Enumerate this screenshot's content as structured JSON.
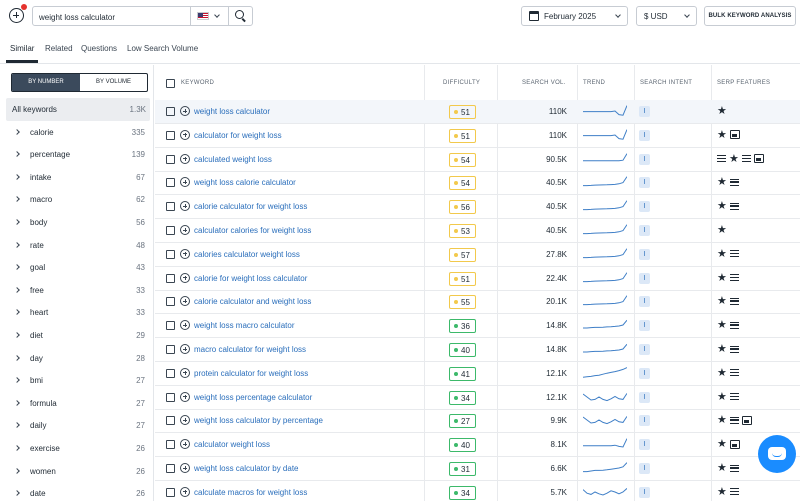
{
  "search": {
    "query": "weight loss calculator"
  },
  "date_dropdown": {
    "label": "February 2025"
  },
  "currency_dropdown": {
    "label": "$ USD"
  },
  "bulk_button": {
    "label": "BULK KEYWORD ANALYSIS"
  },
  "tabs": [
    "Similar",
    "Related",
    "Questions",
    "Low Search Volume"
  ],
  "toggle": {
    "by_number": "BY NUMBER",
    "by_volume": "BY VOLUME"
  },
  "filters": [
    {
      "name": "All keywords",
      "count": "1.3K"
    },
    {
      "name": "calorie",
      "count": "335"
    },
    {
      "name": "percentage",
      "count": "139"
    },
    {
      "name": "intake",
      "count": "67"
    },
    {
      "name": "macro",
      "count": "62"
    },
    {
      "name": "body",
      "count": "56"
    },
    {
      "name": "rate",
      "count": "48"
    },
    {
      "name": "goal",
      "count": "43"
    },
    {
      "name": "free",
      "count": "33"
    },
    {
      "name": "heart",
      "count": "33"
    },
    {
      "name": "diet",
      "count": "29"
    },
    {
      "name": "day",
      "count": "28"
    },
    {
      "name": "bmi",
      "count": "27"
    },
    {
      "name": "formula",
      "count": "27"
    },
    {
      "name": "daily",
      "count": "27"
    },
    {
      "name": "exercise",
      "count": "26"
    },
    {
      "name": "women",
      "count": "26"
    },
    {
      "name": "date",
      "count": "26"
    }
  ],
  "columns": {
    "keyword": "KEYWORD",
    "difficulty": "DIFFICULTY",
    "search_vol": "SEARCH VOL.",
    "trend": "TREND",
    "search_intent": "SEARCH INTENT",
    "serp_features": "SERP FEATURES"
  },
  "colors": {
    "difficulty_yellow": "#f2c94c",
    "difficulty_green": "#3cb96a",
    "link": "#2a6ebb",
    "trend_line": "#3f7fc7"
  },
  "rows": [
    {
      "keyword": "weight loss calculator",
      "difficulty": "51",
      "level": "yellow",
      "volume": "110K",
      "intent": "I",
      "serp": [
        "star"
      ],
      "trend": [
        0.45,
        0.45,
        0.45,
        0.45,
        0.45,
        0.45,
        0.45,
        0.45,
        0.5,
        0.2,
        0.15,
        0.95
      ]
    },
    {
      "keyword": "calculator for weight loss",
      "difficulty": "51",
      "level": "yellow",
      "volume": "110K",
      "intent": "I",
      "serp": [
        "star",
        "image"
      ],
      "trend": [
        0.45,
        0.45,
        0.45,
        0.45,
        0.45,
        0.45,
        0.45,
        0.45,
        0.5,
        0.2,
        0.15,
        0.95
      ]
    },
    {
      "keyword": "calculated weight loss",
      "difficulty": "54",
      "level": "yellow",
      "volume": "90.5K",
      "intent": "I",
      "serp": [
        "list",
        "star",
        "list",
        "image"
      ],
      "trend": [
        0.35,
        0.35,
        0.35,
        0.35,
        0.35,
        0.35,
        0.35,
        0.35,
        0.35,
        0.35,
        0.4,
        0.95
      ]
    },
    {
      "keyword": "weight loss calorie calculator",
      "difficulty": "54",
      "level": "yellow",
      "volume": "40.5K",
      "intent": "I",
      "serp": [
        "star",
        "list"
      ],
      "trend": [
        0.2,
        0.2,
        0.22,
        0.24,
        0.25,
        0.26,
        0.27,
        0.28,
        0.3,
        0.35,
        0.45,
        0.95
      ]
    },
    {
      "keyword": "calorie calculator for weight loss",
      "difficulty": "56",
      "level": "yellow",
      "volume": "40.5K",
      "intent": "I",
      "serp": [
        "star",
        "list"
      ],
      "trend": [
        0.2,
        0.2,
        0.22,
        0.24,
        0.25,
        0.26,
        0.27,
        0.28,
        0.3,
        0.35,
        0.45,
        0.95
      ]
    },
    {
      "keyword": "calculator calories for weight loss",
      "difficulty": "53",
      "level": "yellow",
      "volume": "40.5K",
      "intent": "I",
      "serp": [
        "star"
      ],
      "trend": [
        0.2,
        0.2,
        0.22,
        0.24,
        0.25,
        0.26,
        0.27,
        0.28,
        0.3,
        0.35,
        0.45,
        0.95
      ]
    },
    {
      "keyword": "calories calculator weight loss",
      "difficulty": "57",
      "level": "yellow",
      "volume": "27.8K",
      "intent": "I",
      "serp": [
        "star",
        "list"
      ],
      "trend": [
        0.2,
        0.2,
        0.22,
        0.24,
        0.25,
        0.26,
        0.27,
        0.28,
        0.3,
        0.35,
        0.45,
        0.95
      ]
    },
    {
      "keyword": "calorie for weight loss calculator",
      "difficulty": "51",
      "level": "yellow",
      "volume": "22.4K",
      "intent": "I",
      "serp": [
        "star",
        "list"
      ],
      "trend": [
        0.2,
        0.2,
        0.22,
        0.24,
        0.25,
        0.26,
        0.27,
        0.28,
        0.3,
        0.35,
        0.45,
        0.95
      ]
    },
    {
      "keyword": "calorie calculator and weight loss",
      "difficulty": "55",
      "level": "yellow",
      "volume": "20.1K",
      "intent": "I",
      "serp": [
        "star",
        "list"
      ],
      "trend": [
        0.2,
        0.2,
        0.22,
        0.24,
        0.25,
        0.26,
        0.27,
        0.28,
        0.3,
        0.35,
        0.45,
        0.95
      ]
    },
    {
      "keyword": "weight loss macro calculator",
      "difficulty": "36",
      "level": "green",
      "volume": "14.8K",
      "intent": "I",
      "serp": [
        "star",
        "list"
      ],
      "trend": [
        0.25,
        0.25,
        0.28,
        0.3,
        0.3,
        0.32,
        0.34,
        0.36,
        0.38,
        0.42,
        0.5,
        0.9
      ]
    },
    {
      "keyword": "macro calculator for weight loss",
      "difficulty": "40",
      "level": "green",
      "volume": "14.8K",
      "intent": "I",
      "serp": [
        "star",
        "list"
      ],
      "trend": [
        0.25,
        0.25,
        0.28,
        0.3,
        0.3,
        0.32,
        0.34,
        0.36,
        0.38,
        0.42,
        0.5,
        0.9
      ]
    },
    {
      "keyword": "protein calculator for weight loss",
      "difficulty": "41",
      "level": "green",
      "volume": "12.1K",
      "intent": "I",
      "serp": [
        "star",
        "list"
      ],
      "trend": [
        0.15,
        0.18,
        0.22,
        0.28,
        0.32,
        0.4,
        0.48,
        0.55,
        0.62,
        0.7,
        0.8,
        0.95
      ]
    },
    {
      "keyword": "weight loss percentage calculator",
      "difficulty": "34",
      "level": "green",
      "volume": "12.1K",
      "intent": "I",
      "serp": [
        "star",
        "list"
      ],
      "trend": [
        0.75,
        0.5,
        0.25,
        0.3,
        0.5,
        0.3,
        0.2,
        0.35,
        0.55,
        0.35,
        0.3,
        0.8
      ]
    },
    {
      "keyword": "weight loss calculator by percentage",
      "difficulty": "27",
      "level": "green",
      "volume": "9.9K",
      "intent": "I",
      "serp": [
        "star",
        "list",
        "image"
      ],
      "trend": [
        0.75,
        0.5,
        0.25,
        0.3,
        0.5,
        0.3,
        0.2,
        0.35,
        0.55,
        0.35,
        0.3,
        0.8
      ]
    },
    {
      "keyword": "calculator weight loss",
      "difficulty": "40",
      "level": "green",
      "volume": "8.1K",
      "intent": "I",
      "serp": [
        "star",
        "image"
      ],
      "trend": [
        0.35,
        0.35,
        0.35,
        0.35,
        0.35,
        0.35,
        0.35,
        0.35,
        0.4,
        0.3,
        0.25,
        0.95
      ]
    },
    {
      "keyword": "weight loss calculator by date",
      "difficulty": "31",
      "level": "green",
      "volume": "6.6K",
      "intent": "I",
      "serp": [
        "star",
        "list"
      ],
      "trend": [
        0.2,
        0.2,
        0.25,
        0.3,
        0.3,
        0.32,
        0.35,
        0.4,
        0.45,
        0.5,
        0.6,
        0.95
      ]
    },
    {
      "keyword": "calculate macros for weight loss",
      "difficulty": "34",
      "level": "green",
      "volume": "5.7K",
      "intent": "I",
      "serp": [
        "star",
        "list"
      ],
      "trend": [
        0.7,
        0.4,
        0.3,
        0.5,
        0.35,
        0.25,
        0.4,
        0.6,
        0.5,
        0.35,
        0.5,
        0.8
      ]
    }
  ]
}
